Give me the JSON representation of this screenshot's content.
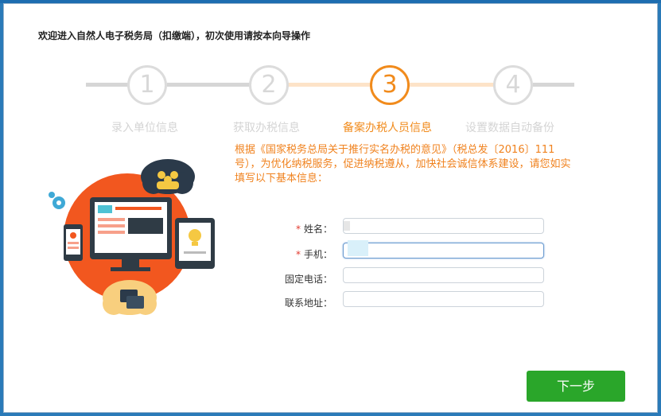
{
  "title": "欢迎进入自然人电子税务局（扣缴端），初次使用请按本向导操作",
  "steps": [
    {
      "number": "1",
      "label": "录入单位信息",
      "state": "inactive"
    },
    {
      "number": "2",
      "label": "获取办税信息",
      "state": "inactive"
    },
    {
      "number": "3",
      "label": "备案办税人员信息",
      "state": "active"
    },
    {
      "number": "4",
      "label": "设置数据自动备份",
      "state": "inactive"
    }
  ],
  "notice": "根据《国家税务总局关于推行实名办税的意见》（税总发〔2016〕111号），为优化纳税服务，促进纳税遵从，加快社会诚信体系建设，请您如实填写以下基本信息：",
  "form": {
    "required_mark": "*",
    "name_label": "姓名：",
    "name_value": "",
    "phone_label": "手机：",
    "phone_value": "",
    "landline_label": "固定电话：",
    "landline_value": "",
    "address_label": "联系地址：",
    "address_value": ""
  },
  "next_button": "下一步",
  "colors": {
    "accent": "#f18b1c",
    "button": "#2aa62a",
    "inactive": "#d4d4d4",
    "illustration": "#f2571f"
  },
  "icons": [
    "people-cloud-icon",
    "chat-cloud-icon",
    "gear-icon",
    "monitor-icon",
    "tablet-icon",
    "phone-icon",
    "lightbulb-icon"
  ]
}
